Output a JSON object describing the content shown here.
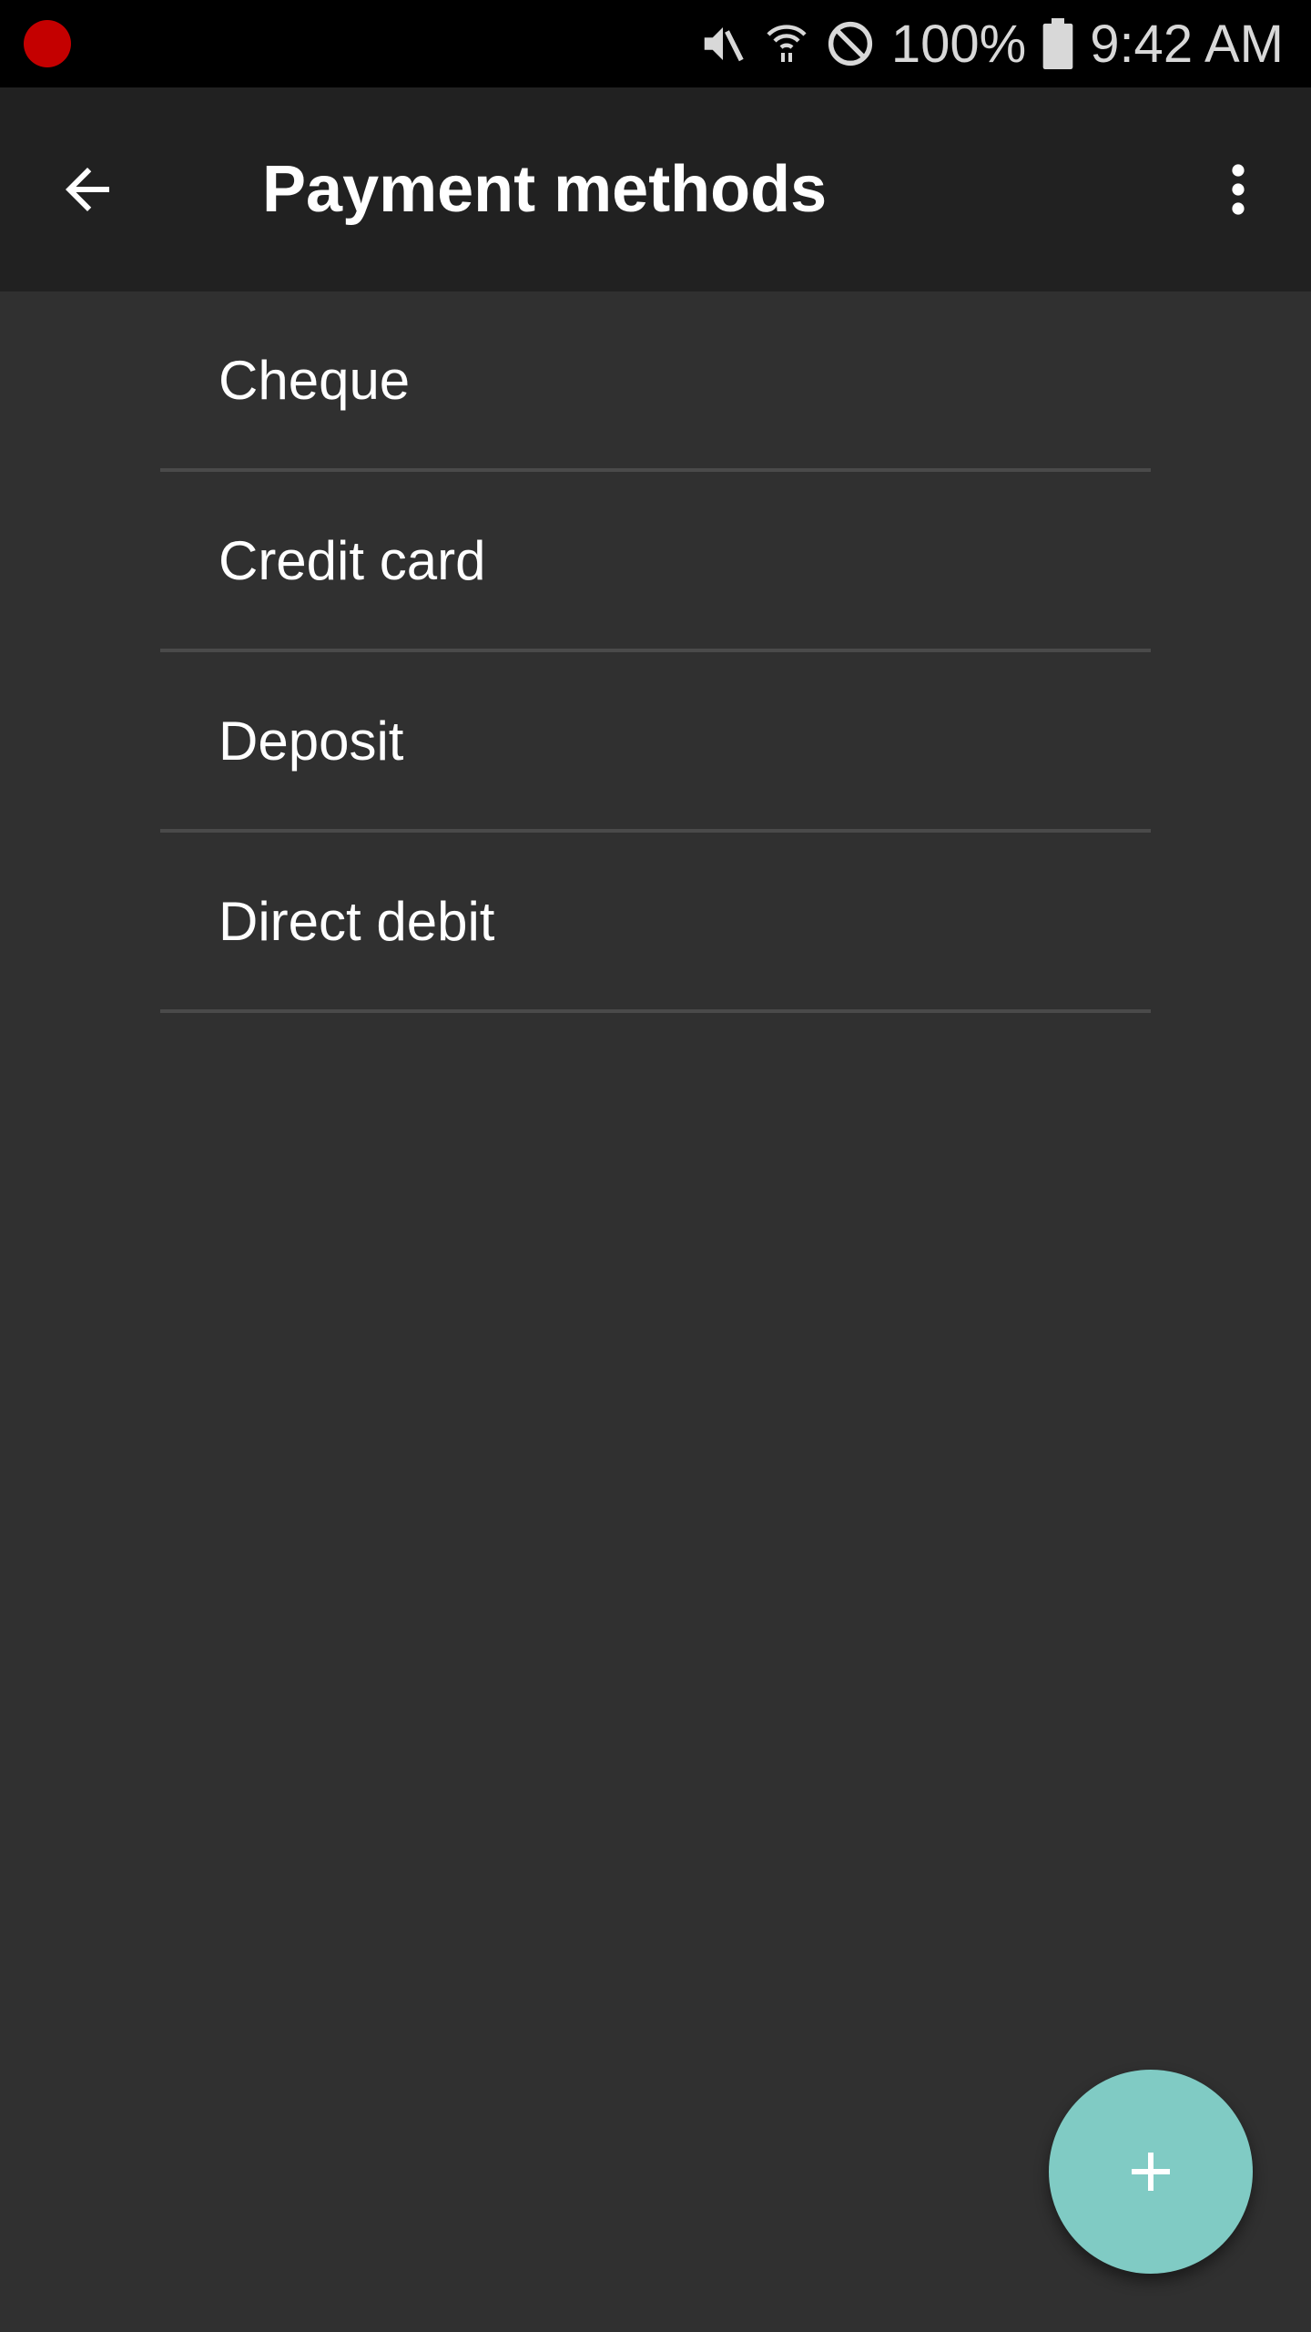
{
  "status_bar": {
    "battery_text": "100%",
    "time": "9:42 AM",
    "icons": [
      "recording-dot-icon",
      "mute-icon",
      "wifi-icon",
      "do-not-disturb-icon",
      "battery-icon"
    ],
    "record_color": "#c40000"
  },
  "app_bar": {
    "title": "Payment methods",
    "back_icon": "arrow-back-icon",
    "menu_icon": "more-vert-icon",
    "background": "#212121"
  },
  "list": {
    "items": [
      {
        "label": "Cheque"
      },
      {
        "label": "Credit card"
      },
      {
        "label": "Deposit"
      },
      {
        "label": "Direct debit"
      }
    ]
  },
  "fab": {
    "icon": "plus-icon",
    "color": "#80cbc4"
  },
  "colors": {
    "background": "#303030",
    "divider": "#4a4a4a",
    "text": "#ffffff"
  }
}
